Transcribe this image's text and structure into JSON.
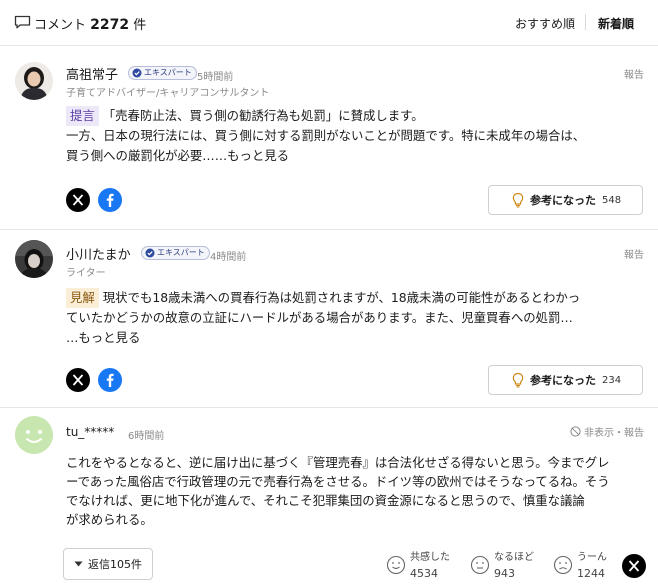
{
  "header": {
    "comment_label": "コメント",
    "comment_count": "2272",
    "count_suffix": "件",
    "sort_recommended": "おすすめ順",
    "sort_newest": "新着順"
  },
  "comments": [
    {
      "author": "高祖常子",
      "badge": "エキスパート",
      "time": "5時間前",
      "subtitle": "子育てアドバイザー/キャリアコンサルタント",
      "report": "報告",
      "tag": "提言",
      "line1": "「売春防止法、買う側の勧誘行為も処罰」に賛成します。",
      "line2": "一方、日本の現行法には、買う側に対する罰則がないことが問題です。特に未成年の場合は、",
      "line3": "買う側への厳罰化が必要…",
      "more": "…もっと見る",
      "helpful_label": "参考になった",
      "helpful_count": "548"
    },
    {
      "author": "小川たまか",
      "badge": "エキスパート",
      "time": "4時間前",
      "subtitle": "ライター",
      "report": "報告",
      "tag": "見解",
      "line1": "現状でも18歳未満への買春行為は処罰されますが、18歳未満の可能性があるとわかっ",
      "line2": "ていたかどうかの故意の立証にハードルがある場合があります。また、児童買春への処罰…",
      "more": "…もっと見る",
      "helpful_label": "参考になった",
      "helpful_count": "234"
    }
  ],
  "user_comment": {
    "author": "tu_*****",
    "time": "6時間前",
    "hide_report": "非表示・報告",
    "line1": "これをやるとなると、逆に届け出に基づく『管理売春』は合法化せざる得ないと思う。今までグレ",
    "line2": "ーであった風俗店で行政管理の元で売春行為をさせる。ドイツ等の欧州ではそうなってるね。そう",
    "line3": "でなければ、更に地下化が進んで、それこそ犯罪集団の資金源になると思うので、慎重な議論",
    "line4": "が求められる。",
    "reply_label": "返信105件",
    "reactions": [
      {
        "label": "共感した",
        "count": "4534"
      },
      {
        "label": "なるほど",
        "count": "943"
      },
      {
        "label": "うーん",
        "count": "1244"
      }
    ]
  },
  "icons": {
    "comment": "comment-bubble-icon",
    "expert": "expert-check-icon",
    "bulb": "lightbulb-icon",
    "x": "x-logo-icon",
    "facebook": "facebook-logo-icon"
  },
  "colors": {
    "facebook": "#1877f2",
    "x": "#000000",
    "teigen_tag_bg": "#ece8f7",
    "kenkai_tag_bg": "#fbeed6"
  }
}
